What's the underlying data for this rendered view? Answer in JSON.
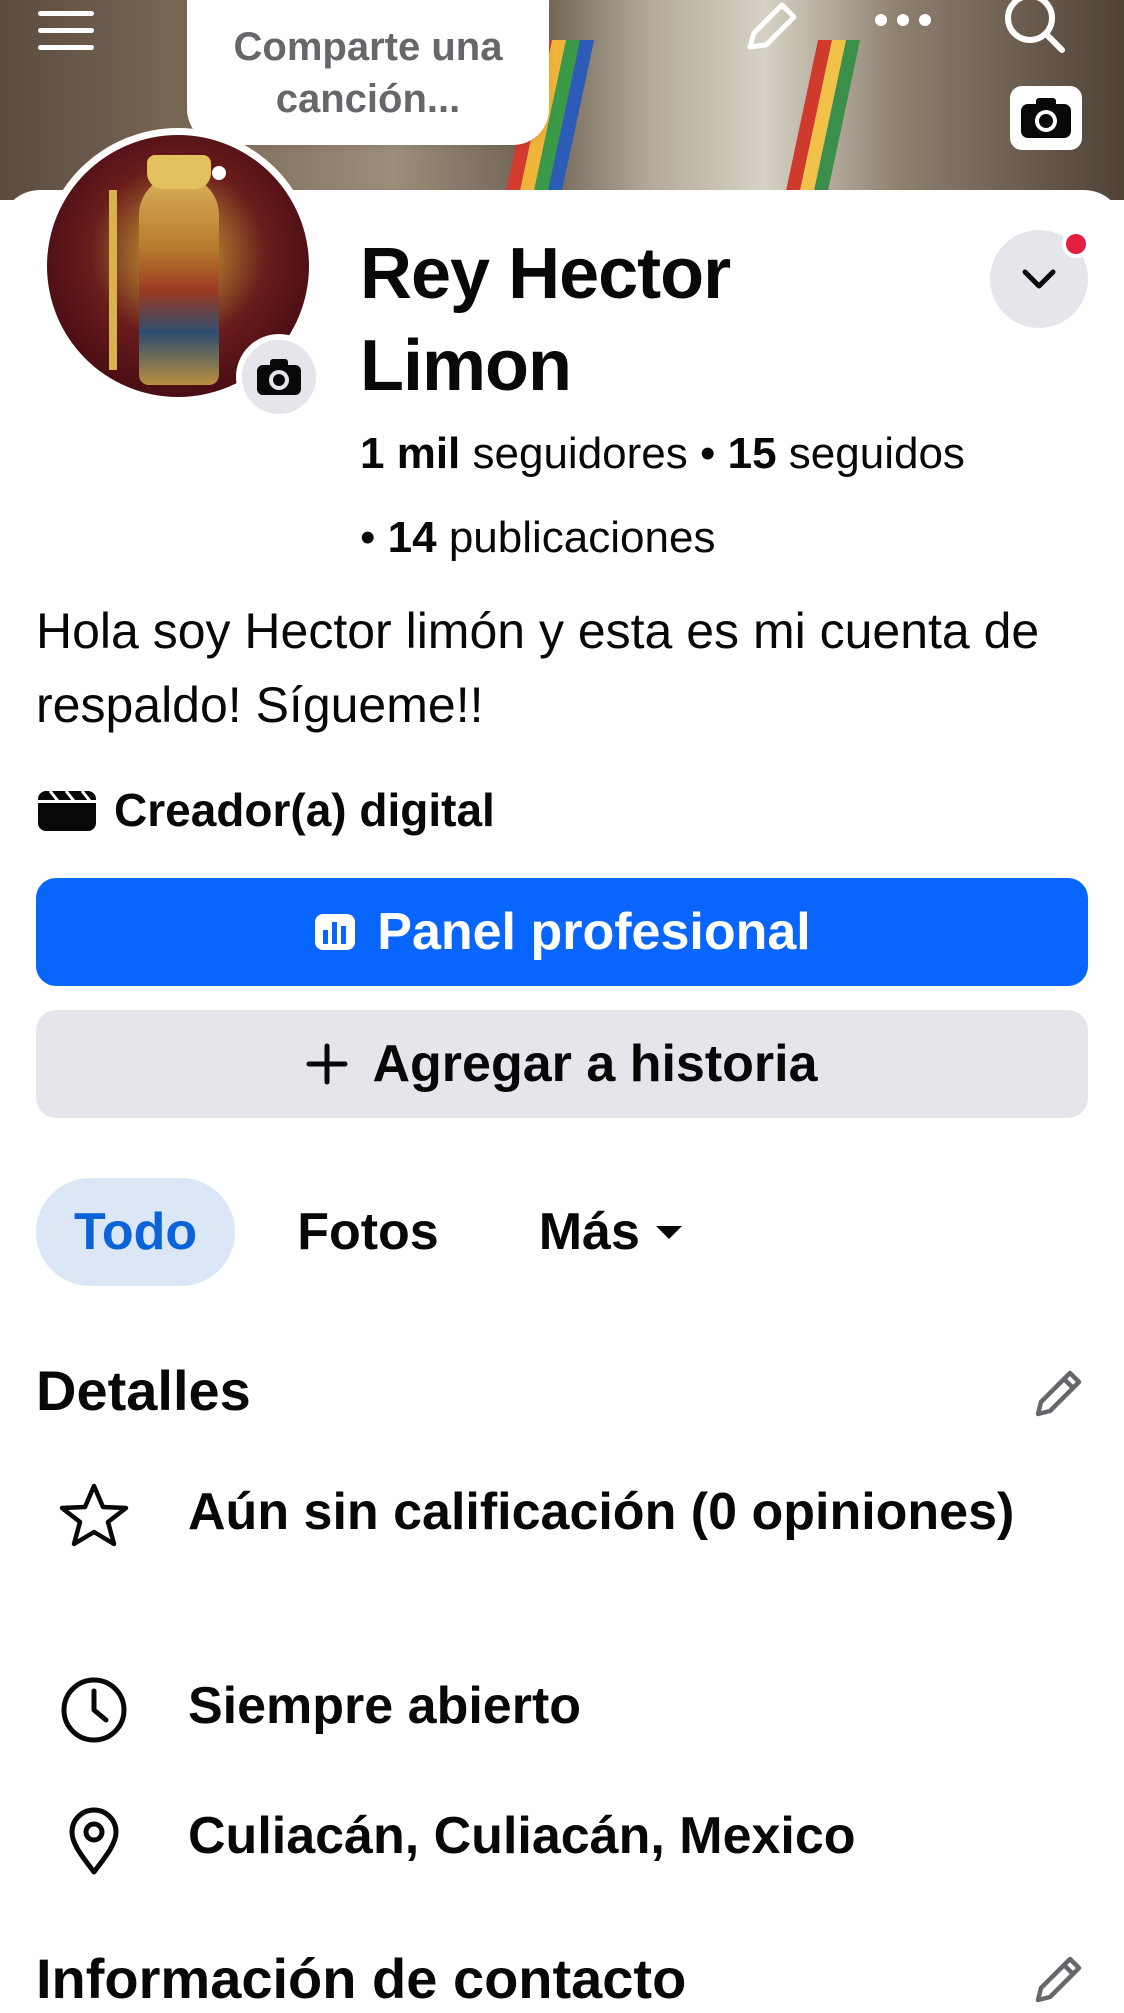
{
  "status_bubble": {
    "text": "Comparte una canción..."
  },
  "profile": {
    "name": "Rey Hector Limon",
    "followers_count": "1 mil",
    "followers_label": " seguidores • ",
    "following_count": "15",
    "following_label": " seguidos",
    "posts_prefix": "• ",
    "posts_count": "14",
    "posts_label": " publicaciones",
    "bio": "Hola soy Hector limón y esta es mi cuenta de respaldo! Sígueme!!",
    "category": "Creador(a) digital"
  },
  "buttons": {
    "professional_panel": "Panel profesional",
    "add_to_story": "Agregar a historia"
  },
  "tabs": [
    {
      "label": "Todo",
      "active": true
    },
    {
      "label": "Fotos",
      "active": false
    },
    {
      "label": "Más",
      "active": false
    }
  ],
  "details": {
    "title": "Detalles",
    "items": [
      {
        "icon": "star-icon",
        "text": "Aún sin calificación (0 opiniones)"
      },
      {
        "icon": "clock-icon",
        "text": "Siempre abierto"
      },
      {
        "icon": "location-pin-icon",
        "text": "Culiacán, Culiacán, Mexico"
      }
    ]
  },
  "contact": {
    "title": "Información de contacto"
  },
  "colors": {
    "primary": "#0866ff",
    "secondary_button": "#e4e6eb",
    "active_tab_bg": "#dbe7f7",
    "active_tab_text": "#0a63d8",
    "notification": "#e41e3f"
  },
  "icons": {
    "top_left": "menu-icon",
    "top_right": [
      "pencil-icon",
      "more-icon",
      "search-icon"
    ],
    "cover": "camera-icon",
    "avatar": "camera-icon",
    "dropdown": "chevron-down-icon",
    "category": "clapperboard-icon",
    "panel": "bar-chart-icon",
    "add": "plus-icon",
    "more_tab": "caret-down-icon"
  }
}
